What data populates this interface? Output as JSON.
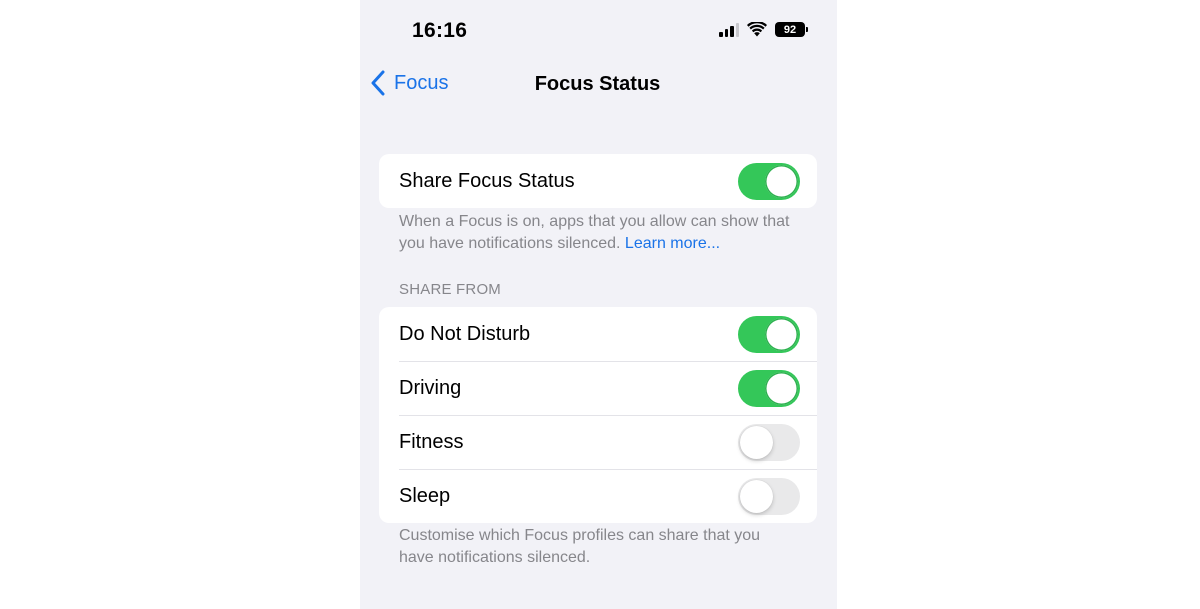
{
  "status_bar": {
    "time": "16:16",
    "signal_icon": "cellular-signal-icon",
    "wifi_icon": "wifi-icon",
    "battery_level": "92"
  },
  "nav": {
    "back_label": "Focus",
    "back_icon": "chevron-left-icon",
    "title": "Focus Status"
  },
  "share_group": {
    "row": {
      "label": "Share Focus Status",
      "enabled": true
    },
    "footer_text": "When a Focus is on, apps that you allow can show that you have notifications silenced. ",
    "footer_link": "Learn more..."
  },
  "share_from": {
    "header": "SHARE FROM",
    "rows": [
      {
        "label": "Do Not Disturb",
        "enabled": true
      },
      {
        "label": "Driving",
        "enabled": true
      },
      {
        "label": "Fitness",
        "enabled": false
      },
      {
        "label": "Sleep",
        "enabled": false
      }
    ],
    "footer_text": "Customise which Focus profiles can share that you have notifications silenced."
  },
  "colors": {
    "accent": "#1a73e8",
    "toggle_on": "#34c759",
    "toggle_off": "#e9e9ea",
    "background": "#f2f2f7"
  }
}
